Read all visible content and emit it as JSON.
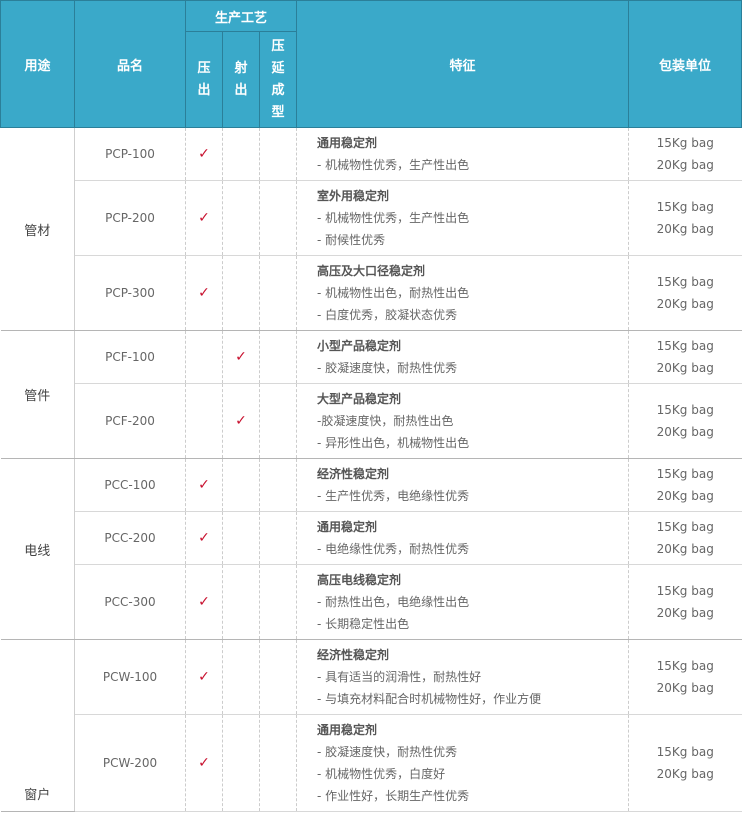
{
  "header": {
    "usage": "用途",
    "product_name": "品名",
    "process": "生产工艺",
    "extrusion": [
      "压",
      "出"
    ],
    "injection": [
      "射",
      "出"
    ],
    "calendering": [
      "压",
      "延",
      "成",
      "型"
    ],
    "features": "特征",
    "packaging": "包装单位"
  },
  "check_mark": "✓",
  "groups": [
    {
      "usage": "管材",
      "rows": [
        {
          "name": "PCP-100",
          "extrusion": true,
          "injection": false,
          "calendering": false,
          "title": "通用稳定剂",
          "lines": [
            "- 机械物性优秀，生产性出色"
          ],
          "pack": [
            "15Kg bag",
            "20Kg bag"
          ]
        },
        {
          "name": "PCP-200",
          "extrusion": true,
          "injection": false,
          "calendering": false,
          "title": "室外用稳定剂",
          "lines": [
            "- 机械物性优秀，生产性出色",
            "- 耐候性优秀"
          ],
          "pack": [
            "15Kg bag",
            "20Kg bag"
          ]
        },
        {
          "name": "PCP-300",
          "extrusion": true,
          "injection": false,
          "calendering": false,
          "title": "高压及大口径稳定剂",
          "lines": [
            "- 机械物性出色，耐热性出色",
            "- 白度优秀，胶凝状态优秀"
          ],
          "pack": [
            "15Kg bag",
            "20Kg bag"
          ]
        }
      ]
    },
    {
      "usage": "管件",
      "rows": [
        {
          "name": "PCF-100",
          "extrusion": false,
          "injection": true,
          "calendering": false,
          "title": "小型产品稳定剂",
          "lines": [
            "- 胶凝速度快，耐热性优秀"
          ],
          "pack": [
            "15Kg bag",
            "20Kg bag"
          ]
        },
        {
          "name": "PCF-200",
          "extrusion": false,
          "injection": true,
          "calendering": false,
          "title": "大型产品稳定剂",
          "lines": [
            "-胶凝速度快，耐热性出色",
            "- 异形性出色，机械物性出色"
          ],
          "pack": [
            "15Kg bag",
            "20Kg bag"
          ]
        }
      ]
    },
    {
      "usage": "电线",
      "rows": [
        {
          "name": "PCC-100",
          "extrusion": true,
          "injection": false,
          "calendering": false,
          "title": "经济性稳定剂",
          "lines": [
            "- 生产性优秀，电绝缘性优秀"
          ],
          "pack": [
            "15Kg bag",
            "20Kg bag"
          ]
        },
        {
          "name": "PCC-200",
          "extrusion": true,
          "injection": false,
          "calendering": false,
          "title": "通用稳定剂",
          "lines": [
            "- 电绝缘性优秀，耐热性优秀"
          ],
          "pack": [
            "15Kg bag",
            "20Kg bag"
          ]
        },
        {
          "name": "PCC-300",
          "extrusion": true,
          "injection": false,
          "calendering": false,
          "title": "高压电线稳定剂",
          "lines": [
            "- 耐热性出色，电绝缘性出色",
            "- 长期稳定性出色"
          ],
          "pack": [
            "15Kg bag",
            "20Kg bag"
          ]
        }
      ]
    },
    {
      "usage": "窗户",
      "rows": [
        {
          "name": "PCW-100",
          "extrusion": true,
          "injection": false,
          "calendering": false,
          "title": "经济性稳定剂",
          "lines": [
            "- 具有适当的润滑性，耐热性好",
            "- 与填充材料配合时机械物性好，作业方便"
          ],
          "pack": [
            "15Kg bag",
            "20Kg bag"
          ]
        },
        {
          "name": "PCW-200",
          "extrusion": true,
          "injection": false,
          "calendering": false,
          "title": "通用稳定剂",
          "lines": [
            "- 胶凝速度快，耐热性优秀",
            "- 机械物性优秀，白度好",
            "- 作业性好，长期生产性优秀"
          ],
          "pack": [
            "15Kg bag",
            "20Kg bag"
          ]
        }
      ]
    }
  ]
}
